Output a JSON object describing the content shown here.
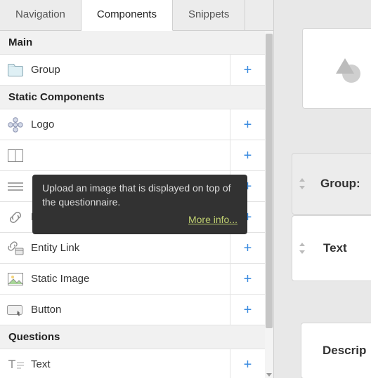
{
  "tabs": {
    "navigation": "Navigation",
    "components": "Components",
    "snippets": "Snippets"
  },
  "sections": {
    "main": "Main",
    "static": "Static Components",
    "questions": "Questions"
  },
  "items": {
    "group": "Group",
    "logo": "Logo",
    "columns": "",
    "lines": "",
    "link": "Link",
    "entityLink": "Entity Link",
    "staticImage": "Static Image",
    "button": "Button",
    "text": "Text"
  },
  "tooltip": {
    "text": "Upload an image that is displayed on top of the questionnaire.",
    "more": "More info..."
  },
  "canvas": {
    "group": "Group:",
    "text": "Text",
    "description": "Descrip"
  },
  "plus": "+"
}
